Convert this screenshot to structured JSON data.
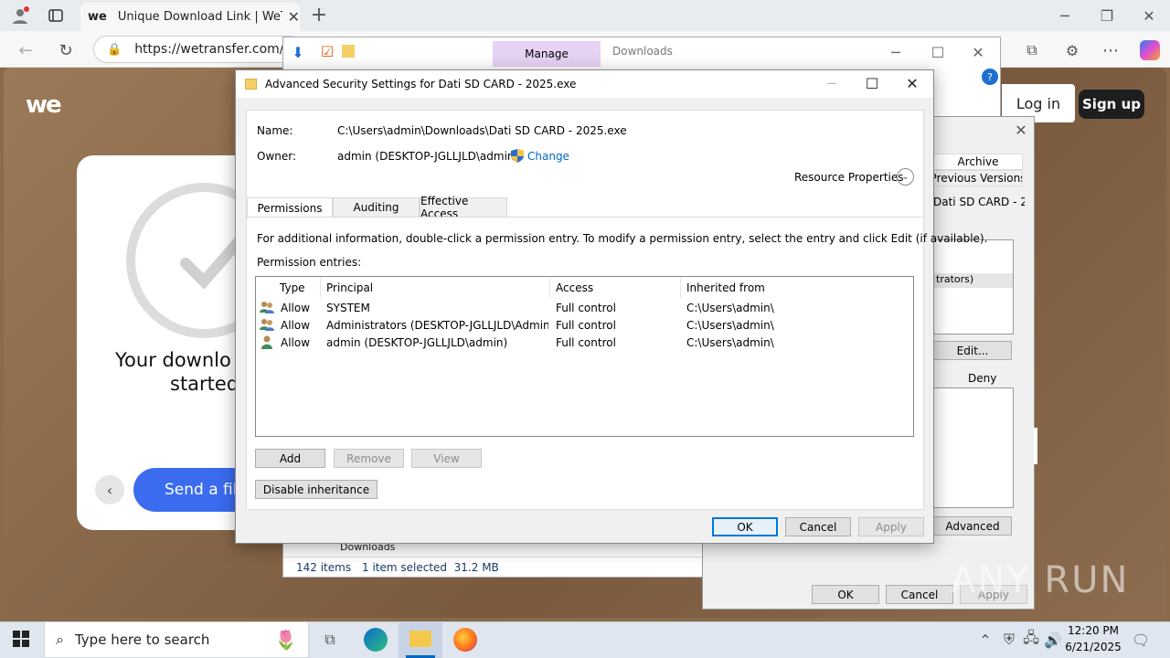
{
  "browser": {
    "tab_title": "Unique Download Link | WeTransfer",
    "tab_logo": "we",
    "url": "https://wetransfer.com/do",
    "new_tab": "+",
    "close_tab": "✕"
  },
  "wetransfer": {
    "logo": "we",
    "headline_line1": "Your downlo",
    "headline_line2": "started",
    "send_button": "Send a file",
    "login": "Log in",
    "signup": "Sign up"
  },
  "explorer": {
    "ribbon_manage": "Manage",
    "ribbon_downloads": "Downloads",
    "nav_item": "Downloads",
    "status_items": "142 items",
    "status_selected": "1 item selected  31.2 MB"
  },
  "properties": {
    "tab_archive": "Archive",
    "tab_prev_versions": "Previous Versions",
    "filename_partial": "Dati SD CARD - 2025",
    "list_partial": "trators)",
    "edit_button": "Edit...",
    "deny_label": "Deny",
    "advanced_button": "Advanced",
    "ok_button": "OK",
    "cancel_button": "Cancel",
    "apply_button": "Apply"
  },
  "dialog": {
    "title": "Advanced Security Settings for Dati SD CARD - 2025.exe",
    "name_label": "Name:",
    "name_value": "C:\\Users\\admin\\Downloads\\Dati SD CARD - 2025.exe",
    "owner_label": "Owner:",
    "owner_value": "admin (DESKTOP-JGLLJLD\\admin)",
    "change_link": "Change",
    "resource_properties": "Resource Properties",
    "tabs": [
      "Permissions",
      "Auditing",
      "Effective Access"
    ],
    "info_text": "For additional information, double-click a permission entry. To modify a permission entry, select the entry and click Edit (if available).",
    "entries_label": "Permission entries:",
    "columns": [
      "Type",
      "Principal",
      "Access",
      "Inherited from"
    ],
    "rows": [
      {
        "type": "Allow",
        "principal": "SYSTEM",
        "access": "Full control",
        "inherited": "C:\\Users\\admin\\"
      },
      {
        "type": "Allow",
        "principal": "Administrators (DESKTOP-JGLLJLD\\Adminis...",
        "access": "Full control",
        "inherited": "C:\\Users\\admin\\"
      },
      {
        "type": "Allow",
        "principal": "admin (DESKTOP-JGLLJLD\\admin)",
        "access": "Full control",
        "inherited": "C:\\Users\\admin\\"
      }
    ],
    "add_button": "Add",
    "remove_button": "Remove",
    "view_button": "View",
    "disable_inheritance_button": "Disable inheritance",
    "ok_button": "OK",
    "cancel_button": "Cancel",
    "apply_button": "Apply"
  },
  "taskbar": {
    "search_placeholder": "Type here to search",
    "time": "12:20 PM",
    "date": "6/21/2025"
  },
  "watermark": "ANY RUN"
}
